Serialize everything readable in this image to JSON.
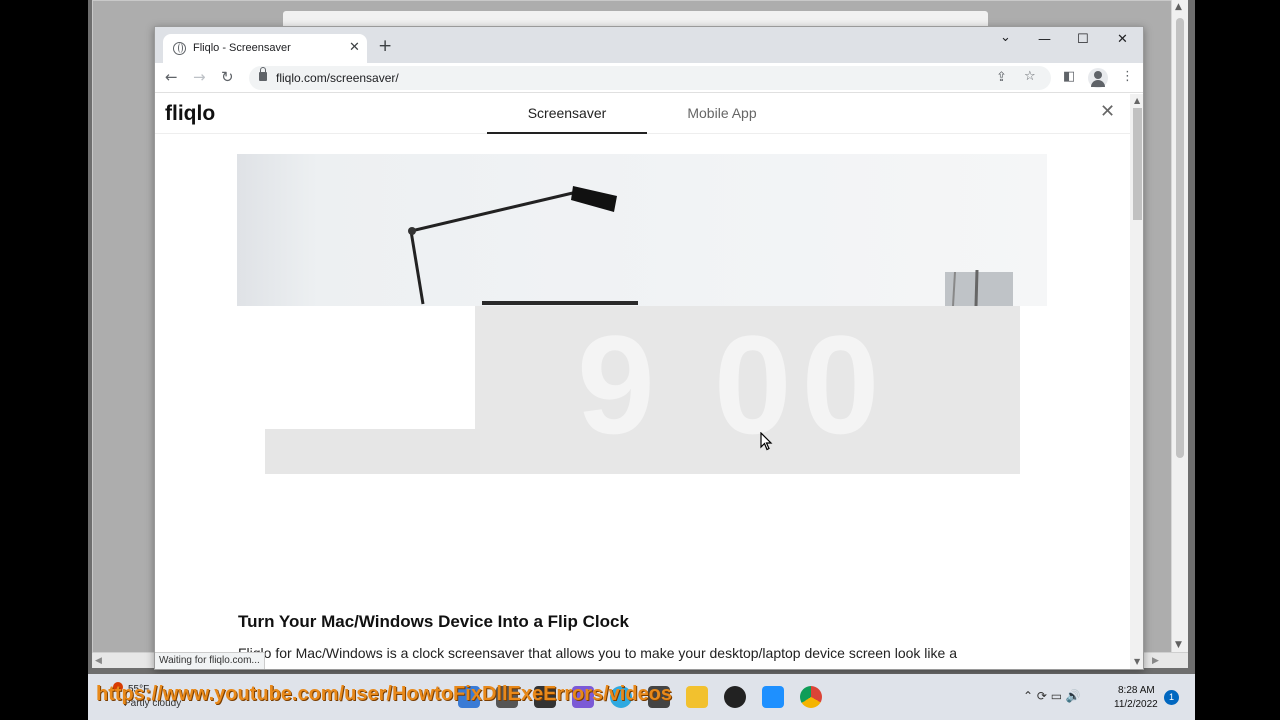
{
  "browser": {
    "tab_title": "Fliqlo - Screensaver",
    "tab_close": "✕",
    "new_tab": "+",
    "url": "fliqlo.com/screensaver/",
    "back": "←",
    "forward": "→",
    "reload": "↻",
    "share": "⇪",
    "bookmark": "☆",
    "sidepanel": "◧",
    "menu": "⋮",
    "minimize": "—",
    "maximize": "☐",
    "close": "✕",
    "tab_search": "⌄"
  },
  "page": {
    "logo": "fliqlo",
    "nav_tabs": [
      {
        "label": "Screensaver",
        "active": true
      },
      {
        "label": "Mobile App",
        "active": false
      }
    ],
    "close": "✕",
    "hero_clock": "9 00",
    "heading": "Turn Your Mac/Windows Device Into a Flip Clock",
    "paragraph": "Fliqlo for Mac/Windows is a clock screensaver that allows you to make your desktop/laptop device screen look like a",
    "status": "Waiting for fliqlo.com..."
  },
  "taskbar": {
    "weather_temp": "55°F",
    "weather_desc": "Partly cloudy",
    "watermark": "https://www.youtube.com/user/HowtoFixDllExeErrors/videos",
    "time": "8:28 AM",
    "date": "11/2/2022",
    "notification_count": "1",
    "tray_icons": "⌃ ⟳ ▭ 🔊"
  },
  "colors": {
    "tabstrip": "#dee1e6",
    "taskbar": "#dfe3ea",
    "watermark": "#e8891a",
    "notification": "#0067c0"
  }
}
